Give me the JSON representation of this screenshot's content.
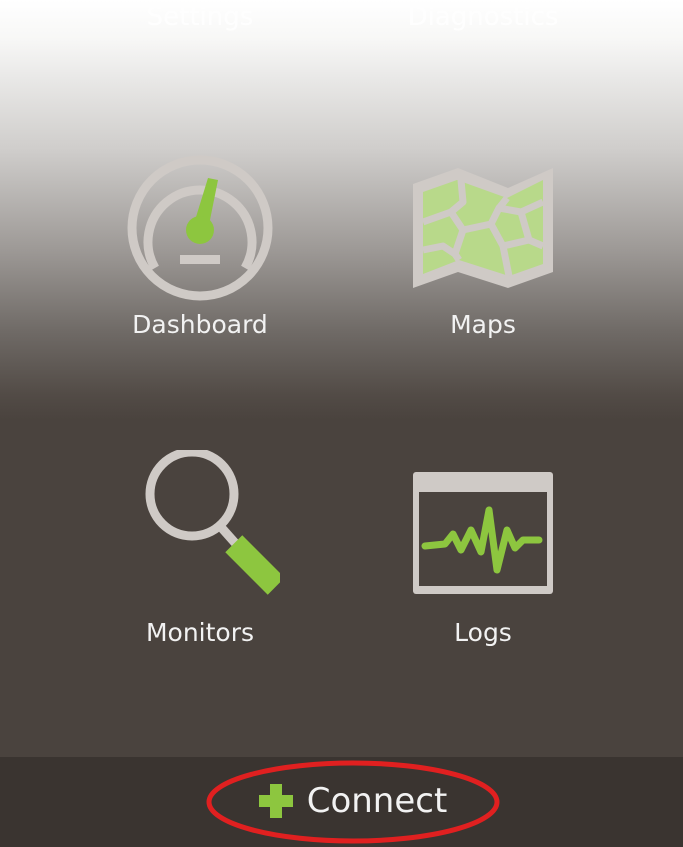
{
  "top_nav": {
    "settings_label": "Settings",
    "diagnostics_label": "Diagnostics"
  },
  "tiles": [
    {
      "label": "Dashboard",
      "icon": "speedometer-icon"
    },
    {
      "label": "Maps",
      "icon": "map-icon"
    },
    {
      "label": "Monitors",
      "icon": "magnifier-icon"
    },
    {
      "label": "Logs",
      "icon": "waveform-log-icon"
    }
  ],
  "connect": {
    "label": "Connect",
    "icon": "plus-icon"
  },
  "colors": {
    "accent_green": "#8dc63f",
    "icon_gray": "#cfcac6",
    "background_dark": "#4a433e",
    "bottom_bar": "#3a3430",
    "annotation_red": "#e02020"
  }
}
